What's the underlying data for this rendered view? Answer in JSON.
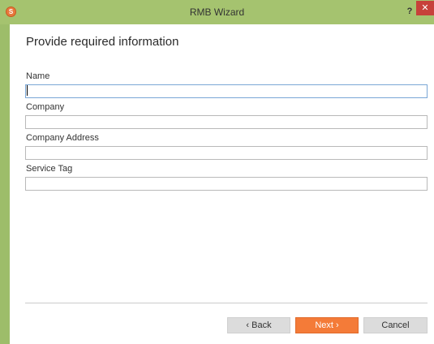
{
  "window": {
    "title": "RMB Wizard",
    "help_label": "?",
    "close_label": "✕",
    "icon_label": "S"
  },
  "form": {
    "heading": "Provide required information",
    "fields": [
      {
        "label": "Name",
        "value": "",
        "placeholder": ""
      },
      {
        "label": "Company",
        "value": "",
        "placeholder": ""
      },
      {
        "label": "Company Address",
        "value": "",
        "placeholder": ""
      },
      {
        "label": "Service Tag",
        "value": "",
        "placeholder": ""
      }
    ]
  },
  "buttons": {
    "back": "‹ Back",
    "next": "Next ›",
    "cancel": "Cancel"
  },
  "colors": {
    "titlebar": "#a5c36f",
    "close": "#c7413a",
    "primary": "#f47b38"
  },
  "icons": [
    "app-logo-icon",
    "help-icon",
    "close-icon"
  ]
}
